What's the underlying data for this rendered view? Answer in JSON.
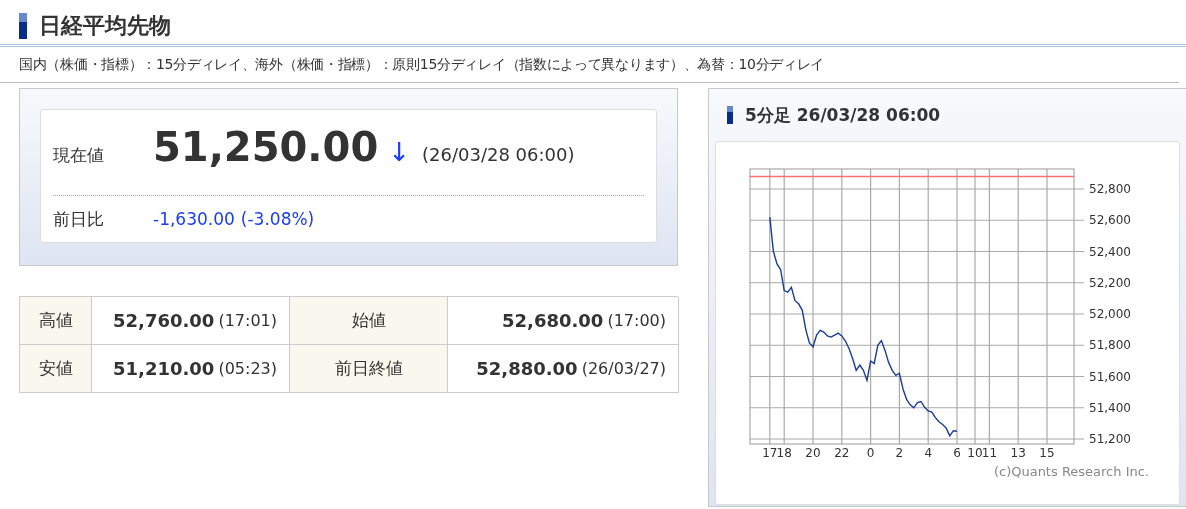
{
  "title": "日経平均先物",
  "notice": "国内（株価・指標）：15分ディレイ、海外（株価・指標）：原則15分ディレイ（指数によって異なります）、為替：10分ディレイ",
  "quote": {
    "price_label": "現在値",
    "price": "51,250.00",
    "arrow": "↓",
    "timestamp": "(26/03/28 06:00)",
    "change_label": "前日比",
    "change": "-1,630.00",
    "change_percent": "(-3.08%)"
  },
  "stats": [
    {
      "label": "高値",
      "value": "52,760.00",
      "time": "(17:01)"
    },
    {
      "label": "始値",
      "value": "52,680.00",
      "time": "(17:00)"
    },
    {
      "label": "安値",
      "value": "51,210.00",
      "time": "(05:23)"
    },
    {
      "label": "前日終値",
      "value": "52,880.00",
      "time": "(26/03/27)"
    }
  ],
  "chart_panel": {
    "title": "5分足 26/03/28 06:00",
    "copyright": "(c)Quants Research Inc.",
    "chart_data": {
      "type": "line",
      "grid": true,
      "ylim": [
        51168,
        52928
      ],
      "categories": [
        null,
        null,
        null,
        null,
        null,
        "17",
        null,
        null,
        null,
        "18",
        null,
        null,
        null,
        null,
        null,
        null,
        null,
        "20",
        null,
        null,
        null,
        null,
        null,
        null,
        null,
        "22",
        null,
        null,
        null,
        null,
        null,
        null,
        null,
        "0",
        null,
        null,
        null,
        null,
        null,
        null,
        null,
        "2",
        null,
        null,
        null,
        null,
        null,
        null,
        null,
        "4",
        null,
        null,
        null,
        null,
        null,
        null,
        null,
        "6",
        null,
        null,
        null,
        null,
        "10",
        null,
        null,
        null,
        "11",
        null,
        null,
        null,
        null,
        null,
        null,
        null,
        "13",
        null,
        null,
        null,
        null,
        null,
        null,
        null,
        "15",
        null,
        null,
        null,
        null,
        null,
        null,
        null
      ],
      "yticks": [
        {
          "value": 51200,
          "label": "51,200"
        },
        {
          "value": 51400,
          "label": "51,400"
        },
        {
          "value": 51600,
          "label": "51,600"
        },
        {
          "value": 51800,
          "label": "51,800"
        },
        {
          "value": 52000,
          "label": "52,000"
        },
        {
          "value": 52200,
          "label": "52,200"
        },
        {
          "value": 52400,
          "label": "52,400"
        },
        {
          "value": 52600,
          "label": "52,600"
        },
        {
          "value": 52800,
          "label": "52,800"
        }
      ],
      "series": [
        {
          "color": "#1a3c9a",
          "values": [
            null,
            null,
            null,
            null,
            null,
            52620,
            52400,
            52320,
            52285,
            52150,
            52140,
            52170,
            52085,
            52065,
            52025,
            51900,
            51815,
            51790,
            51865,
            51895,
            51885,
            51860,
            51852,
            51865,
            51878,
            51860,
            51827,
            51780,
            51715,
            51640,
            51673,
            51640,
            51575,
            51700,
            51683,
            51800,
            51830,
            51767,
            51690,
            51640,
            51607,
            51620,
            51520,
            51453,
            51419,
            51400,
            51433,
            51440,
            51403,
            51380,
            51372,
            51337,
            51310,
            51293,
            51270,
            51220,
            51253,
            51250,
            null,
            null,
            null,
            null,
            null,
            null,
            null,
            null,
            null,
            null,
            null,
            null,
            null,
            null,
            null,
            null,
            null,
            null,
            null,
            null,
            null,
            null,
            null,
            null,
            null,
            null,
            null,
            null,
            null,
            null,
            null,
            null
          ]
        }
      ],
      "ref_lines": [
        {
          "axis": "y",
          "value": 52880,
          "color": "#ff7070"
        }
      ]
    }
  }
}
